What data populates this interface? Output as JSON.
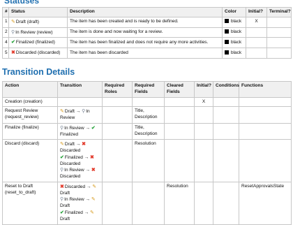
{
  "status_section_title": "Statuses",
  "status_headers": [
    "#",
    "Status",
    "Description",
    "Color",
    "Initial?",
    "Terminal?"
  ],
  "statuses": [
    {
      "num": "1",
      "icon": "pencil",
      "label": "Draft (draft)",
      "description": "The item has been created and is ready to be defined.",
      "color": "black",
      "initial": "X",
      "terminal": ""
    },
    {
      "num": "2",
      "icon": "in-review",
      "label": "In Review (review)",
      "description": "The item is done and now waiting for a review.",
      "color": "black",
      "initial": "",
      "terminal": ""
    },
    {
      "num": "4",
      "icon": "check",
      "label": "Finalized (finalized)",
      "description": "The item has been finalized and does not require any more activities.",
      "color": "black",
      "initial": "",
      "terminal": ""
    },
    {
      "num": "5",
      "icon": "cross",
      "label": "Discarded (discarded)",
      "description": "The item has been discarded",
      "color": "black",
      "initial": "",
      "terminal": ""
    }
  ],
  "transition_section_title": "Transition Details",
  "transition_headers": [
    "Action",
    "Transition",
    "Required Roles",
    "Required Fields",
    "Cleared Fields",
    "Initial?",
    "Conditions",
    "Functions"
  ],
  "transitions": [
    {
      "action": "Creation (creation)",
      "lines": [],
      "roles": "",
      "fields": "",
      "cleared": "",
      "initial": "X",
      "conditions": "",
      "functions": ""
    },
    {
      "action": "Request Review (request_review)",
      "lines": [
        {
          "from_icon": "pencil",
          "from": "Draft",
          "to_icon": "in-review",
          "to": "In Review"
        }
      ],
      "roles": "",
      "fields": "Title, Description",
      "cleared": "",
      "initial": "",
      "conditions": "",
      "functions": ""
    },
    {
      "action": "Finalize (finalize)",
      "lines": [
        {
          "from_icon": "in-review",
          "from": "In Review",
          "to_icon": "check",
          "to": "Finalized"
        }
      ],
      "roles": "",
      "fields": "Title, Description",
      "cleared": "",
      "initial": "",
      "conditions": "",
      "functions": ""
    },
    {
      "action": "Discard (discard)",
      "lines": [
        {
          "from_icon": "pencil",
          "from": "Draft",
          "to_icon": "cross",
          "to": "Discarded"
        },
        {
          "from_icon": "check",
          "from": "Finalized",
          "to_icon": "cross",
          "to": "Discarded"
        },
        {
          "from_icon": "in-review",
          "from": "In Review",
          "to_icon": "cross",
          "to": "Discarded"
        }
      ],
      "roles": "",
      "fields": "Resolution",
      "cleared": "",
      "initial": "",
      "conditions": "",
      "functions": ""
    },
    {
      "action": "Reset to Draft (reset_to_draft)",
      "lines": [
        {
          "from_icon": "cross",
          "from": "Discarded",
          "to_icon": "pencil",
          "to": "Draft"
        },
        {
          "from_icon": "in-review",
          "from": "In Review",
          "to_icon": "pencil",
          "to": "Draft"
        },
        {
          "from_icon": "check",
          "from": "Finalized",
          "to_icon": "pencil",
          "to": "Draft"
        }
      ],
      "roles": "",
      "fields": "",
      "cleared": "Resolution",
      "initial": "",
      "conditions": "",
      "functions": "ResetApprovalsState"
    }
  ],
  "arrow": "→",
  "icon_glyphs": {
    "pencil": "✎",
    "in-review": "⚲",
    "check": "✔",
    "cross": "✖"
  },
  "colors": {
    "heading": "#1f6fb0",
    "header_bg": "#f0f0f0",
    "border": "#c7c7c7",
    "pencil": "#d69a1c",
    "check": "#27a33b",
    "cross": "#e23a2b"
  }
}
